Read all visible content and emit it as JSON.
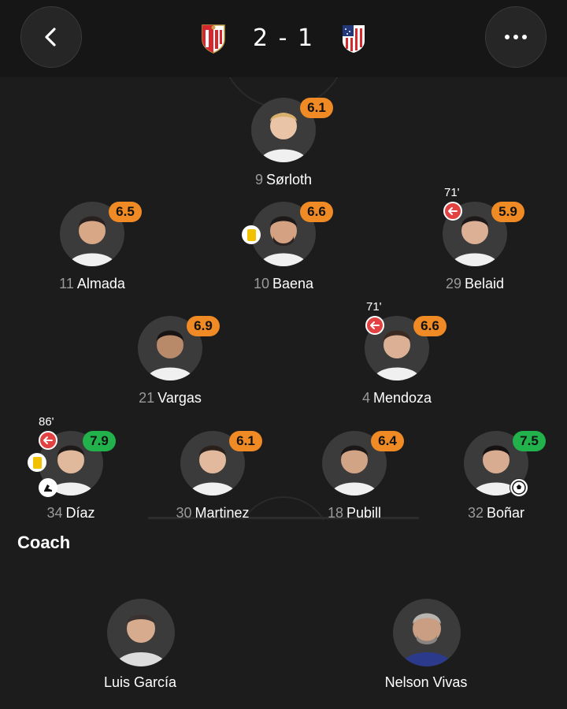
{
  "header": {
    "back_icon": "chevron-left-icon",
    "more_icon": "ellipsis-icon",
    "home_team_crest": "sevilla-crest",
    "away_team_crest": "atletico-madrid-crest",
    "score": "2 - 1",
    "colors": {
      "home_red": "#d7272e",
      "away_red": "#d32a2d",
      "away_blue": "#23387a"
    }
  },
  "players": {
    "sorloth": {
      "number": "9",
      "name": "Sørloth",
      "rating": "6.1"
    },
    "almada": {
      "number": "11",
      "name": "Almada",
      "rating": "6.5"
    },
    "baena": {
      "number": "10",
      "name": "Baena",
      "rating": "6.6"
    },
    "belaid": {
      "number": "29",
      "name": "Belaid",
      "rating": "5.9",
      "sub_minute": "71'"
    },
    "vargas": {
      "number": "21",
      "name": "Vargas",
      "rating": "6.9"
    },
    "mendoza": {
      "number": "4",
      "name": "Mendoza",
      "rating": "6.6",
      "sub_minute": "71'"
    },
    "diaz": {
      "number": "34",
      "name": "Díaz",
      "rating": "7.9",
      "sub_minute": "86'"
    },
    "martinez": {
      "number": "30",
      "name": "Martinez",
      "rating": "6.1"
    },
    "pubill": {
      "number": "18",
      "name": "Pubill",
      "rating": "6.4"
    },
    "bonar": {
      "number": "32",
      "name": "Boñar",
      "rating": "7.5"
    }
  },
  "rating_colors": {
    "orange": "#f08a24",
    "green": "#22b24c"
  },
  "coach": {
    "title": "Coach",
    "home": {
      "name": "Luis García"
    },
    "away": {
      "name": "Nelson Vivas"
    }
  }
}
